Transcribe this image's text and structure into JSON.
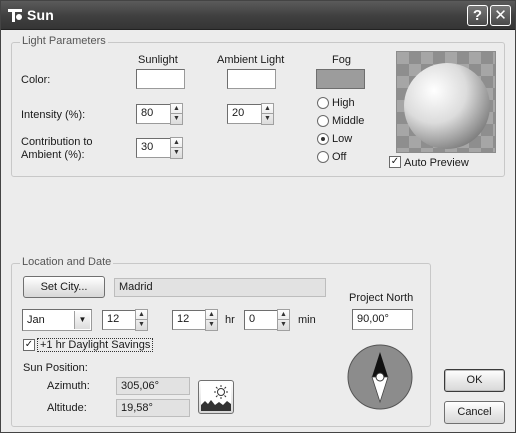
{
  "window": {
    "title": "Sun",
    "help_label": "?",
    "close_label": "✕"
  },
  "light_parameters": {
    "group_title": "Light Parameters",
    "col_sunlight": "Sunlight",
    "col_ambient": "Ambient Light",
    "col_fog": "Fog",
    "color_label": "Color:",
    "intensity_label": "Intensity (%):",
    "contribution_label_line1": "Contribution to",
    "contribution_label_line2": "Ambient (%):",
    "sunlight_intensity": "80",
    "ambient_intensity": "20",
    "sunlight_contribution": "30",
    "fog_options": [
      {
        "label": "High",
        "selected": false
      },
      {
        "label": "Middle",
        "selected": false
      },
      {
        "label": "Low",
        "selected": true
      },
      {
        "label": "Off",
        "selected": false
      }
    ],
    "auto_preview_label": "Auto Preview",
    "auto_preview_checked": true
  },
  "location": {
    "group_title": "Location and Date",
    "set_city_label": "Set City...",
    "city": "Madrid",
    "month": "Jan",
    "day": "12",
    "hour": "12",
    "hour_unit": "hr",
    "minute": "0",
    "minute_unit": "min",
    "daylight_label": "+1 hr Daylight Savings",
    "daylight_checked": true,
    "sun_position_label": "Sun Position:",
    "azimuth_label": "Azimuth:",
    "azimuth_value": "305,06°",
    "altitude_label": "Altitude:",
    "altitude_value": "19,58°",
    "project_north_label": "Project North",
    "project_north_value": "90,00°"
  },
  "buttons": {
    "ok_label": "OK",
    "cancel_label": "Cancel"
  },
  "icons": [
    "sun-icon",
    "help-icon",
    "close-icon",
    "sun-landscape-icon",
    "compass-icon",
    "dropdown-arrow-icon",
    "spin-up-icon",
    "spin-down-icon"
  ]
}
